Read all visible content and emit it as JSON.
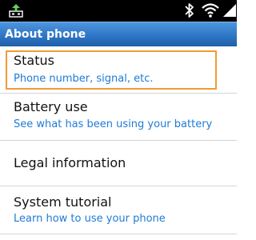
{
  "status_bar": {
    "icons": [
      "usb-debug-icon",
      "bluetooth-icon",
      "wifi-icon",
      "signal-icon"
    ]
  },
  "header": {
    "title": "About phone"
  },
  "settings": {
    "items": [
      {
        "title": "Status",
        "subtitle": "Phone number, signal, etc."
      },
      {
        "title": "Battery use",
        "subtitle": "See what has been using your battery"
      },
      {
        "title": "Legal information"
      },
      {
        "title": "System tutorial",
        "subtitle": "Learn how to use your phone"
      }
    ]
  },
  "colors": {
    "title_bar": "#2f76c6",
    "subtitle_text": "#1d7bd8",
    "focus_highlight": "#f09a37"
  }
}
